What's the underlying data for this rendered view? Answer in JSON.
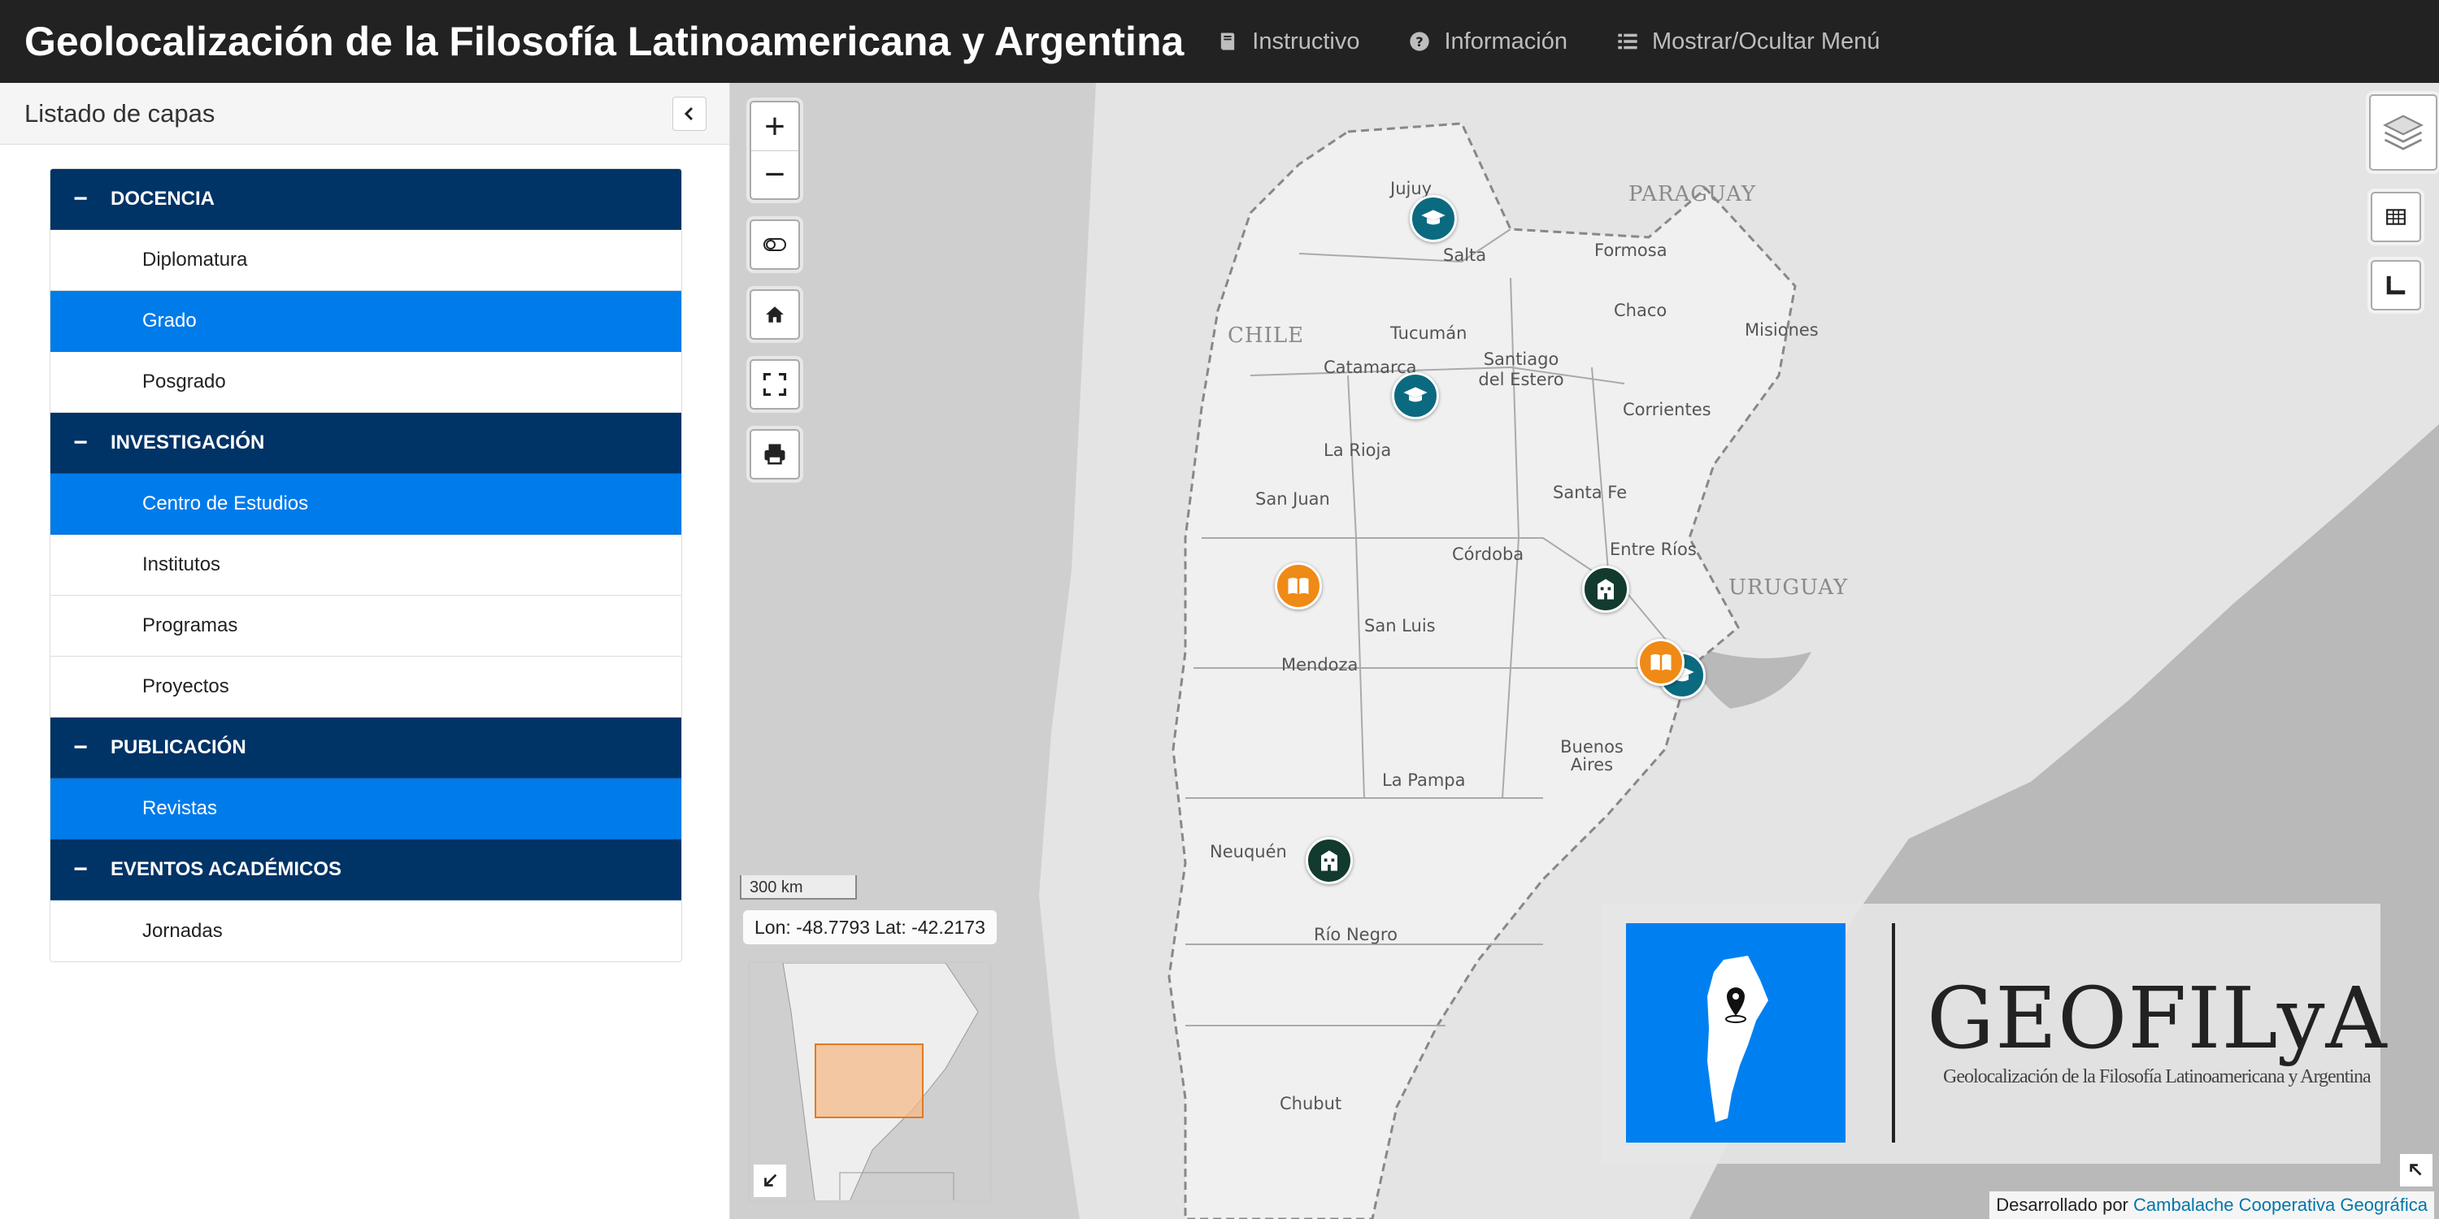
{
  "app": {
    "title": "Geolocalización de la Filosofía Latinoamericana y Argentina"
  },
  "navbar": {
    "items": [
      {
        "label": "Instructivo",
        "icon": "book-icon"
      },
      {
        "label": "Información",
        "icon": "question-circle-icon"
      },
      {
        "label": "Mostrar/Ocultar Menú",
        "icon": "list-icon"
      }
    ]
  },
  "sidebar": {
    "title": "Listado de capas",
    "groups": [
      {
        "label": "DOCENCIA",
        "toggle": "−",
        "items": [
          {
            "label": "Diplomatura",
            "active": false
          },
          {
            "label": "Grado",
            "active": true
          },
          {
            "label": "Posgrado",
            "active": false
          }
        ]
      },
      {
        "label": "INVESTIGACIÓN",
        "toggle": "−",
        "items": [
          {
            "label": "Centro de Estudios",
            "active": true
          },
          {
            "label": "Institutos",
            "active": false
          },
          {
            "label": "Programas",
            "active": false
          },
          {
            "label": "Proyectos",
            "active": false
          }
        ]
      },
      {
        "label": "PUBLICACIÓN",
        "toggle": "−",
        "items": [
          {
            "label": "Revistas",
            "active": true
          }
        ]
      },
      {
        "label": "EVENTOS ACADÉMICOS",
        "toggle": "−",
        "items": [
          {
            "label": "Jornadas",
            "active": false
          }
        ]
      }
    ]
  },
  "map": {
    "zoom_in": "+",
    "zoom_out": "−",
    "scale": "300 km",
    "coords": "Lon: -48.7793 Lat: -42.2173",
    "countries": [
      "PARAGUAY",
      "CHILE",
      "URUGUAY"
    ],
    "provinces": [
      "Jujuy",
      "Salta",
      "Formosa",
      "Chaco",
      "Tucumán",
      "Santiago del Estero",
      "Misiones",
      "Catamarca",
      "Corrientes",
      "La Rioja",
      "San Juan",
      "Santa Fe",
      "Córdoba",
      "Entre Ríos",
      "San Luis",
      "Mendoza",
      "Buenos Aires",
      "La Pampa",
      "Neuquén",
      "Río Negro",
      "Chubut"
    ],
    "markers": [
      {
        "type": "graduation-cap",
        "color": "#0b6a80"
      },
      {
        "type": "graduation-cap",
        "color": "#0b6a80"
      },
      {
        "type": "book",
        "color": "#f08a16"
      },
      {
        "type": "building",
        "color": "#123a2e"
      },
      {
        "type": "book",
        "color": "#f08a16"
      },
      {
        "type": "graduation-cap",
        "color": "#0b6a80"
      },
      {
        "type": "building",
        "color": "#123a2e"
      }
    ],
    "logo": {
      "title": "GEOFILyA",
      "subtitle": "Geolocalización de la Filosofía Latinoamericana y Argentina"
    },
    "attribution": {
      "prefix": "Desarrollado por",
      "link": "Cambalache Cooperativa Geográfica"
    }
  },
  "colors": {
    "navbar": "#222222",
    "group_header": "#003366",
    "active_item": "#007bea",
    "accent_link": "#0077aa"
  }
}
